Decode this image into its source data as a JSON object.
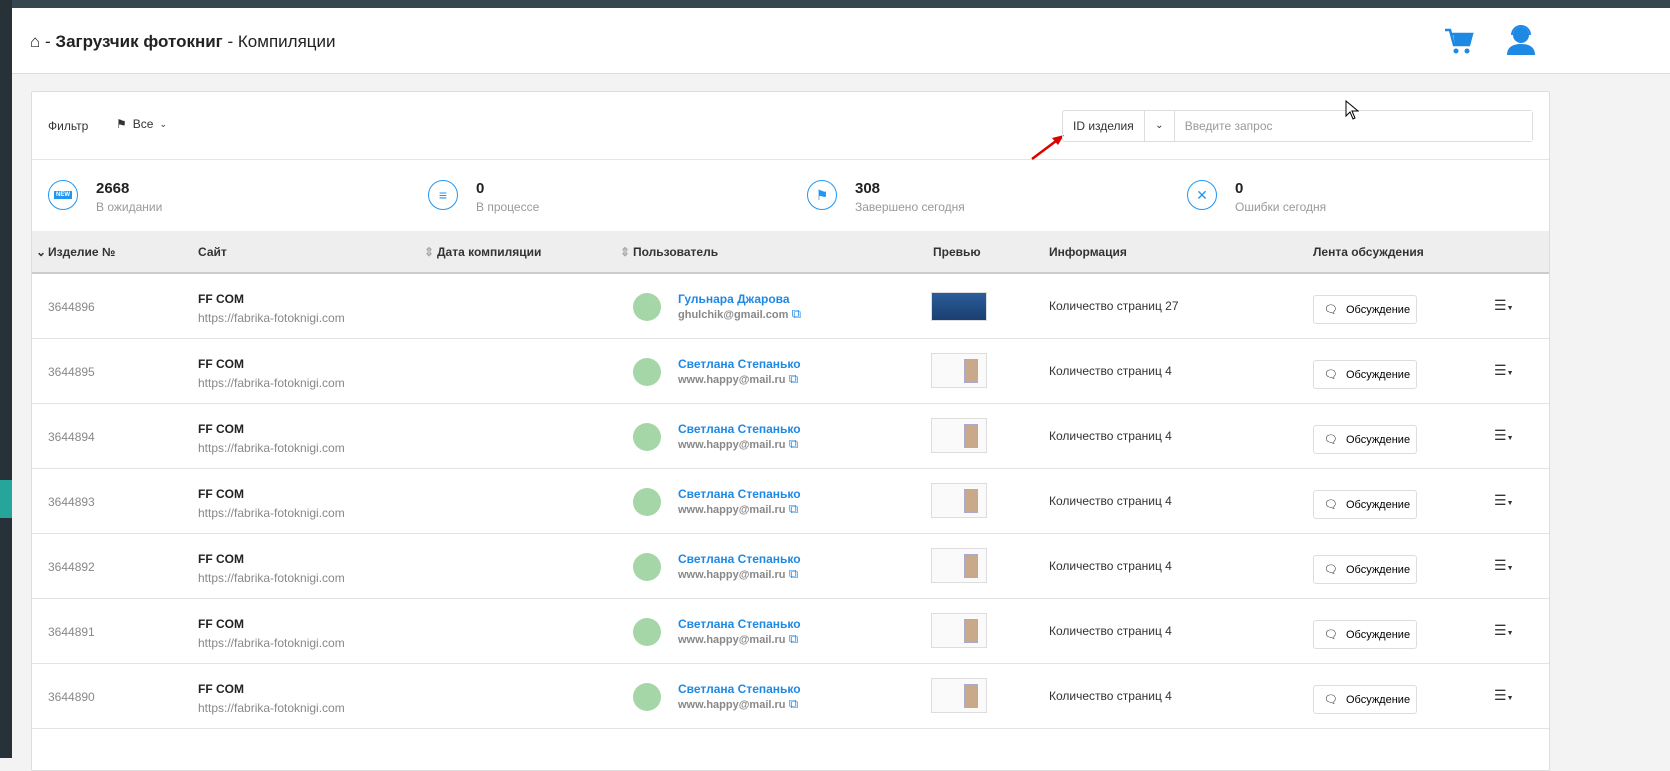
{
  "header": {
    "home_icon": "home-icon",
    "app": "Загрузчик фотокниг",
    "sep": "-",
    "page": "Компиляции"
  },
  "filter": {
    "label": "Фильтр",
    "value": "Все"
  },
  "search": {
    "type": "ID изделия",
    "placeholder": "Введите запрос"
  },
  "stats": [
    {
      "value": "2668",
      "label": "В ожидании",
      "icon": "NEW"
    },
    {
      "value": "0",
      "label": "В процессе",
      "icon": "≡"
    },
    {
      "value": "308",
      "label": "Завершено сегодня",
      "icon": "⚑"
    },
    {
      "value": "0",
      "label": "Ошибки сегодня",
      "icon": "✕"
    }
  ],
  "columns": {
    "id": "Изделие №",
    "site": "Сайт",
    "date": "Дата компиляции",
    "user": "Пользователь",
    "preview": "Превью",
    "info": "Информация",
    "feed": "Лента обсуждения"
  },
  "discuss_label": "Обсуждение",
  "rows": [
    {
      "id": "3644896",
      "site": "FF COM",
      "url": "https://fabrika-fotoknigi.com",
      "name": "Гульнара Джарова",
      "email": "ghulchik@gmail.com",
      "info": "Количество страниц 27"
    },
    {
      "id": "3644895",
      "site": "FF COM",
      "url": "https://fabrika-fotoknigi.com",
      "name": "Светлана Степанько",
      "email": "www.happy@mail.ru",
      "info": "Количество страниц 4"
    },
    {
      "id": "3644894",
      "site": "FF COM",
      "url": "https://fabrika-fotoknigi.com",
      "name": "Светлана Степанько",
      "email": "www.happy@mail.ru",
      "info": "Количество страниц 4"
    },
    {
      "id": "3644893",
      "site": "FF COM",
      "url": "https://fabrika-fotoknigi.com",
      "name": "Светлана Степанько",
      "email": "www.happy@mail.ru",
      "info": "Количество страниц 4"
    },
    {
      "id": "3644892",
      "site": "FF COM",
      "url": "https://fabrika-fotoknigi.com",
      "name": "Светлана Степанько",
      "email": "www.happy@mail.ru",
      "info": "Количество страниц 4"
    },
    {
      "id": "3644891",
      "site": "FF COM",
      "url": "https://fabrika-fotoknigi.com",
      "name": "Светлана Степанько",
      "email": "www.happy@mail.ru",
      "info": "Количество страниц 4"
    },
    {
      "id": "3644890",
      "site": "FF COM",
      "url": "https://fabrika-fotoknigi.com",
      "name": "Светлана Степанько",
      "email": "www.happy@mail.ru",
      "info": "Количество страниц 4"
    }
  ]
}
